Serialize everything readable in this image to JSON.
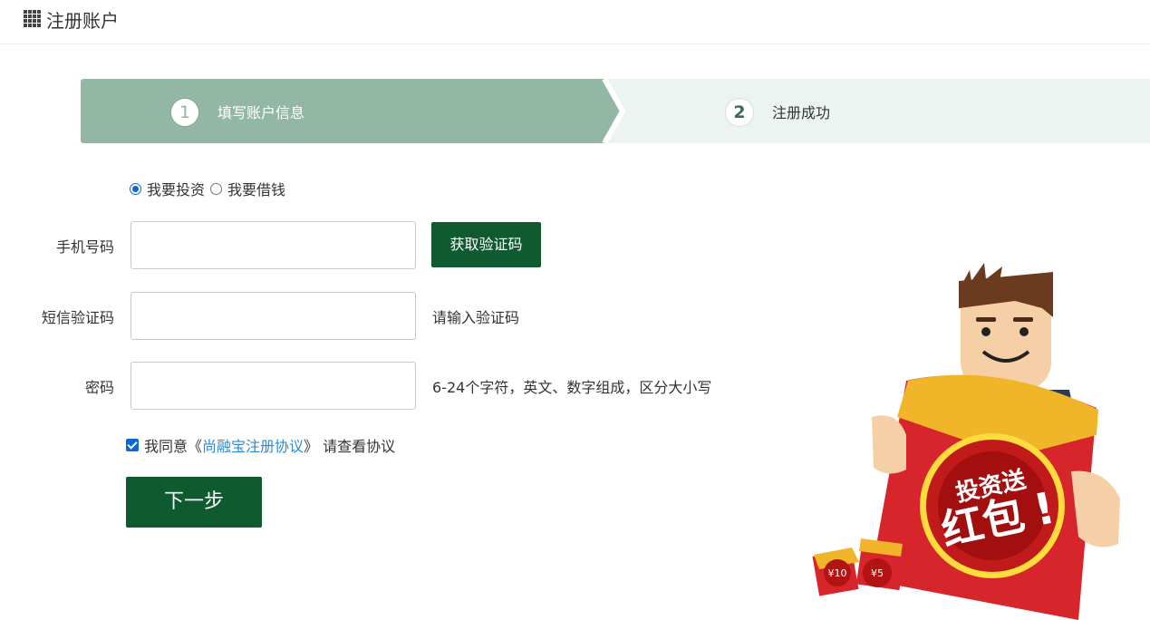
{
  "header": {
    "icon": "grid-icon",
    "title": "注册账户"
  },
  "steps": [
    {
      "number": "1",
      "label": "填写账户信息",
      "active": true
    },
    {
      "number": "2",
      "label": "注册成功",
      "active": false
    }
  ],
  "role": {
    "options": [
      "我要投资",
      "我要借钱"
    ],
    "selected": "我要投资"
  },
  "form": {
    "phone": {
      "label": "手机号码",
      "value": ""
    },
    "get_code_button": "获取验证码",
    "sms": {
      "label": "短信验证码",
      "value": "",
      "hint": "请输入验证码"
    },
    "password": {
      "label": "密码",
      "value": "",
      "hint": "6-24个字符，英文、数字组成，区分大小写"
    }
  },
  "agreement": {
    "checked": true,
    "prefix": "我同意",
    "open_quote": "《",
    "link_text": "尚融宝注册协议",
    "close_quote": "》",
    "suffix": " 请查看协议"
  },
  "next_button": "下一步",
  "promo": {
    "badge_line1": "投资送",
    "badge_line2": "红包",
    "coupon_1": "¥10",
    "coupon_2": "¥5"
  },
  "colors": {
    "brand_green": "#0f5a2f",
    "step_active": "#92b8a5",
    "step_inactive": "#ecf4f1",
    "link": "#2f8ad2"
  }
}
